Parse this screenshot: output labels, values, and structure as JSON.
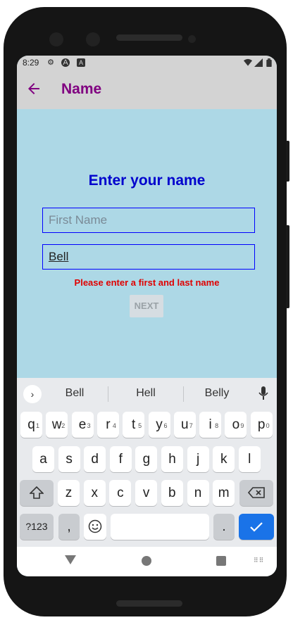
{
  "status_bar": {
    "time": "8:29",
    "icons": [
      "gear-icon",
      "a-circle-icon",
      "a-square-icon",
      "wifi-icon",
      "signal-icon",
      "battery-icon"
    ]
  },
  "app_bar": {
    "back_icon": "arrow-left-icon",
    "title": "Name",
    "title_color": "#800080",
    "background": "#d3d3d3"
  },
  "form": {
    "heading": "Enter your name",
    "first_name": {
      "value": "",
      "placeholder": "First Name"
    },
    "last_name": {
      "value": "Bell",
      "placeholder": ""
    },
    "error": "Please enter a first and last name",
    "next_label": "NEXT",
    "background": "#add8e6"
  },
  "keyboard": {
    "suggestions": [
      "Bell",
      "Hell",
      "Belly"
    ],
    "row1": [
      {
        "key": "q",
        "hint": "1"
      },
      {
        "key": "w",
        "hint": "2"
      },
      {
        "key": "e",
        "hint": "3"
      },
      {
        "key": "r",
        "hint": "4"
      },
      {
        "key": "t",
        "hint": "5"
      },
      {
        "key": "y",
        "hint": "6"
      },
      {
        "key": "u",
        "hint": "7"
      },
      {
        "key": "i",
        "hint": "8"
      },
      {
        "key": "o",
        "hint": "9"
      },
      {
        "key": "p",
        "hint": "0"
      }
    ],
    "row2": [
      "a",
      "s",
      "d",
      "f",
      "g",
      "h",
      "j",
      "k",
      "l"
    ],
    "row3": [
      "z",
      "x",
      "c",
      "v",
      "b",
      "n",
      "m"
    ],
    "symbols_label": "?123",
    "comma_label": ",",
    "period_label": ".",
    "enter_color": "#1a73e8"
  }
}
